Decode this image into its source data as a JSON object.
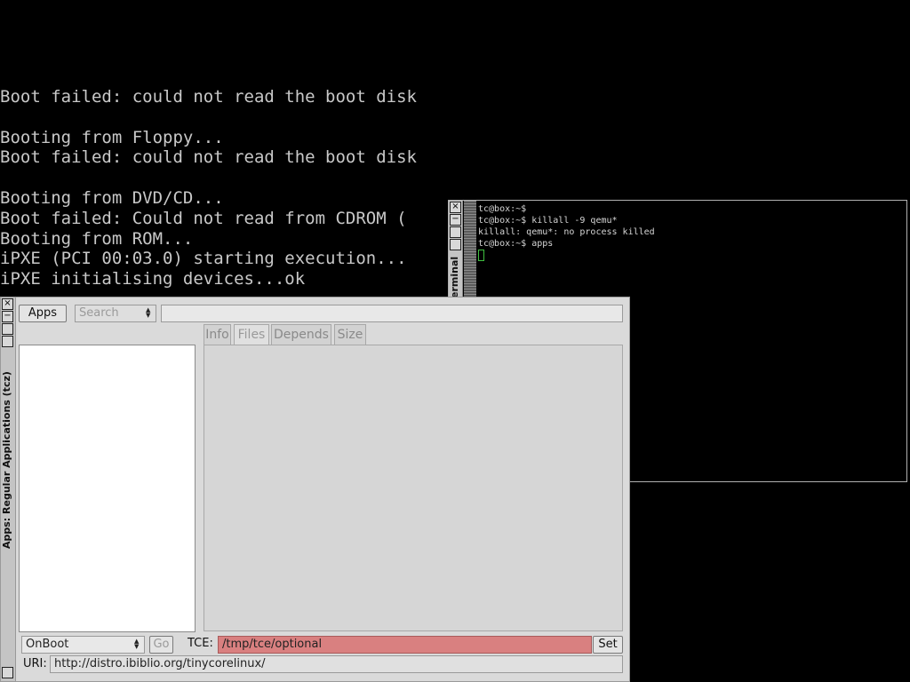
{
  "console": {
    "lines": [
      "Boot failed: could not read the boot disk",
      "",
      "Booting from Floppy...",
      "Boot failed: could not read the boot disk",
      "",
      "Booting from DVD/CD...",
      "Boot failed: Could not read from CDROM (",
      "Booting from ROM...",
      "iPXE (PCI 00:03.0) starting execution...",
      "iPXE initialising devices...ok"
    ]
  },
  "terminal": {
    "title": "Terminal",
    "lines": [
      "tc@box:~$",
      "tc@box:~$ killall -9 qemu*",
      "killall: qemu*: no process killed",
      "tc@box:~$ apps"
    ],
    "cursor_color": "#3fbf3f"
  },
  "apps_window": {
    "title": "Apps: Regular Applications (tcz)",
    "apps_button": "Apps",
    "search_label": "Search",
    "tabs": [
      "Info",
      "Files",
      "Depends",
      "Size"
    ],
    "active_tab": "Files",
    "onboot_value": "OnBoot",
    "go_button": "Go",
    "tce_label": "TCE:",
    "tce_path": "/tmp/tce/optional",
    "tce_path_color": "#d98080",
    "set_button": "Set",
    "uri_label": "URI:",
    "uri_value": "http://distro.ibiblio.org/tinycorelinux/"
  },
  "window_buttons": {
    "close": "×",
    "minimize": "−"
  }
}
